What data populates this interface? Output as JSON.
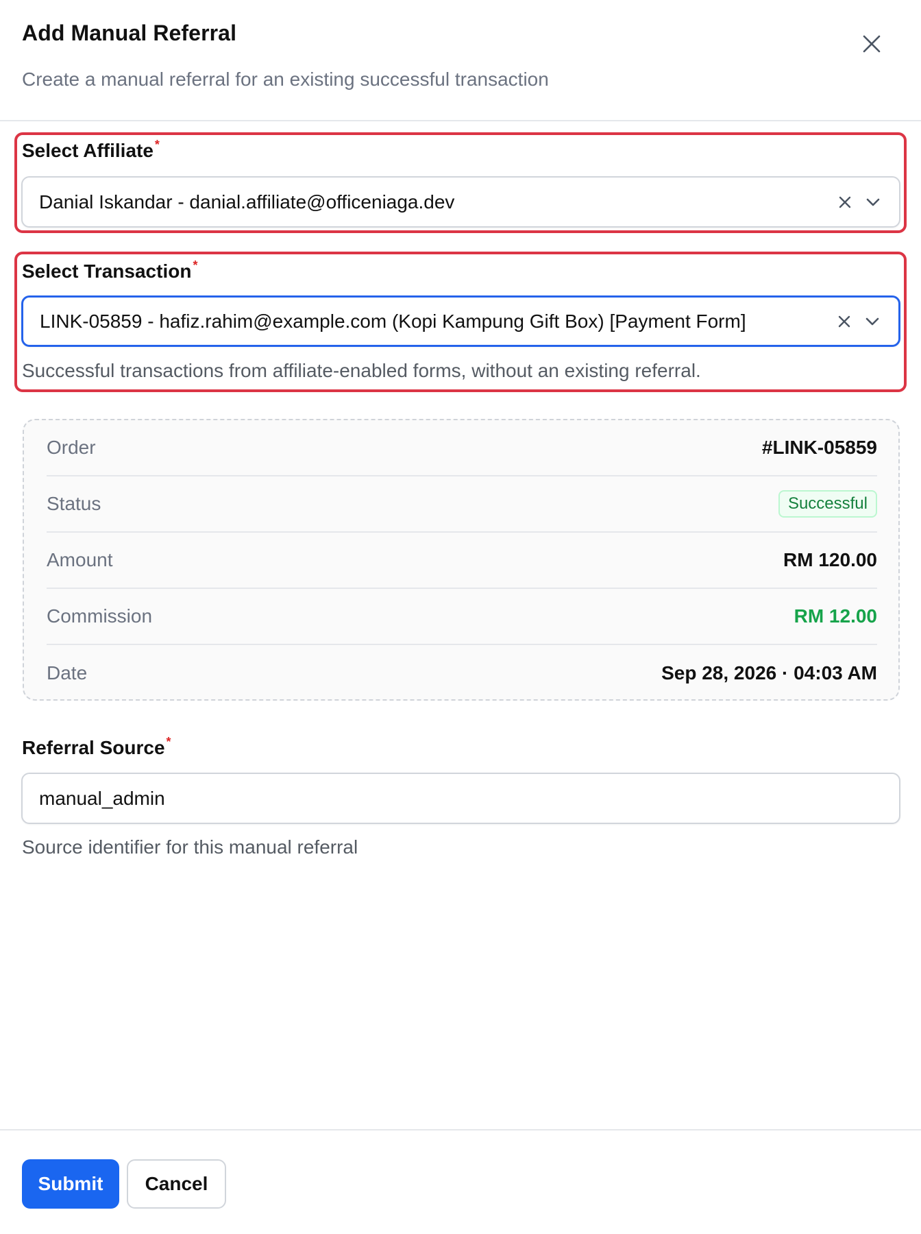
{
  "dialog": {
    "title": "Add Manual Referral",
    "subtitle": "Create a manual referral for an existing successful transaction"
  },
  "affiliate": {
    "label": "Select Affiliate",
    "required_mark": "*",
    "value": "Danial Iskandar - danial.affiliate@officeniaga.dev"
  },
  "transaction": {
    "label": "Select Transaction",
    "required_mark": "*",
    "value": "LINK-05859 - hafiz.rahim@example.com (Kopi Kampung Gift Box) [Payment Form]",
    "help": "Successful transactions from affiliate-enabled forms, without an existing referral."
  },
  "details": {
    "rows": [
      {
        "label": "Order",
        "value": "#LINK-05859"
      },
      {
        "label": "Status",
        "value": "Successful"
      },
      {
        "label": "Amount",
        "value": "RM 120.00"
      },
      {
        "label": "Commission",
        "value": "RM 12.00"
      },
      {
        "label": "Date",
        "value": "Sep 28, 2026 · 04:03 AM"
      }
    ]
  },
  "source": {
    "label": "Referral Source",
    "required_mark": "*",
    "value": "manual_admin",
    "help": "Source identifier for this manual referral"
  },
  "footer": {
    "submit_label": "Submit",
    "cancel_label": "Cancel"
  },
  "colors": {
    "primary": "#1a66f0",
    "highlight": "#dc3545",
    "success": "#16a34a",
    "focus": "#2563eb"
  },
  "icons": {
    "close": "close-icon",
    "clear": "clear-x-icon",
    "dropdown": "chevron-down-icon"
  }
}
